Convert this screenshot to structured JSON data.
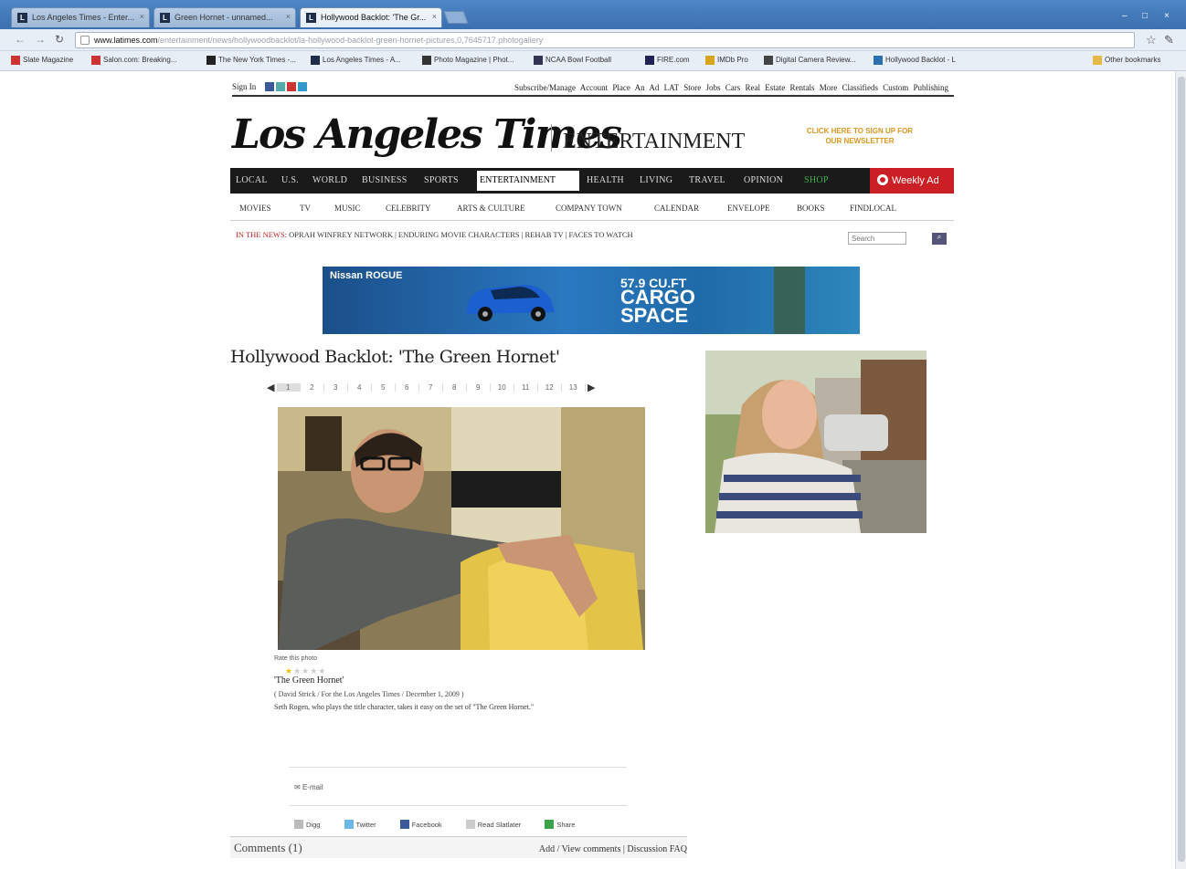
{
  "browser": {
    "tabs": [
      {
        "label": "Los Angeles Times - Enter..."
      },
      {
        "label": "Green Hornet - unnamed..."
      },
      {
        "label": "Hollywood Backlot: 'The Gr..."
      }
    ],
    "url_domain": "www.latimes.com",
    "url_path": "/entertainment/news/hollywoodbacklot/la-hollywood-backlot-green-hornet-pictures,0,7645717.photogallery",
    "bookmarks": [
      "Slate Magazine",
      "Salon.com: Breaking...",
      "The New York Times -...",
      "Los Angeles Times - A...",
      "Photo Magazine | Phot...",
      "NCAA Bowl Football",
      "FIRE.com",
      "IMDb Pro",
      "Digital Camera Review...",
      "Hollywood Backlot - L"
    ],
    "other_bookmarks": "Other bookmarks"
  },
  "site": {
    "utility": {
      "signin": "Sign In",
      "links": "Subscribe/Manage Account   Place An Ad   LAT Store   Jobs   Cars   Real Estate   Rentals   More Classifieds   Custom Publishing"
    },
    "masthead": "Los Angeles Times",
    "section": "ENTERTAINMENT",
    "newsletter": "CLICK HERE TO SIGN UP FOR OUR NEWSLETTER",
    "mainnav": [
      {
        "label": "LOCAL"
      },
      {
        "label": "U.S."
      },
      {
        "label": "WORLD"
      },
      {
        "label": "BUSINESS"
      },
      {
        "label": "SPORTS"
      },
      {
        "label": "ENTERTAINMENT"
      },
      {
        "label": "HEALTH"
      },
      {
        "label": "LIVING"
      },
      {
        "label": "TRAVEL"
      },
      {
        "label": "OPINION"
      },
      {
        "label": "SHOP"
      }
    ],
    "weekly_ad": "Weekly Ad",
    "subnav": [
      "MOVIES",
      "TV",
      "MUSIC",
      "CELEBRITY",
      "ARTS & CULTURE",
      "COMPANY TOWN",
      "CALENDAR",
      "ENVELOPE",
      "BOOKS",
      "FINDLOCAL"
    ],
    "in_the_news_label": "IN THE NEWS:",
    "in_the_news": "OPRAH WINFREY NETWORK  |  ENDURING MOVIE CHARACTERS  |  REHAB TV  |  FACES TO WATCH",
    "search_placeholder": "Search"
  },
  "ad": {
    "brand": "Nissan ROGUE",
    "line1": "57.9 CU.FT",
    "line2": "CARGO",
    "line3": "SPACE"
  },
  "gallery": {
    "title": "Hollywood Backlot: 'The Green Hornet'",
    "pages": [
      "1",
      "2",
      "3",
      "4",
      "5",
      "6",
      "7",
      "8",
      "9",
      "10",
      "11",
      "12",
      "13"
    ],
    "current_page": 1,
    "rate_label": "Rate this photo",
    "rating": 1,
    "rating_max": 5,
    "caption_title": "'The Green Hornet'",
    "credit": "( David Strick / For the Los Angeles Times / December 1, 2009 )",
    "caption": "Seth Rogen, who plays the title character, takes it easy on the set of \"The Green Hornet.\"",
    "email_label": "E-mail",
    "share": [
      "Digg",
      "Twitter",
      "Facebook",
      "Read Slatlater",
      "Share"
    ],
    "comments_title": "Comments (1)",
    "comments_links": "Add / View comments | Discussion FAQ"
  }
}
